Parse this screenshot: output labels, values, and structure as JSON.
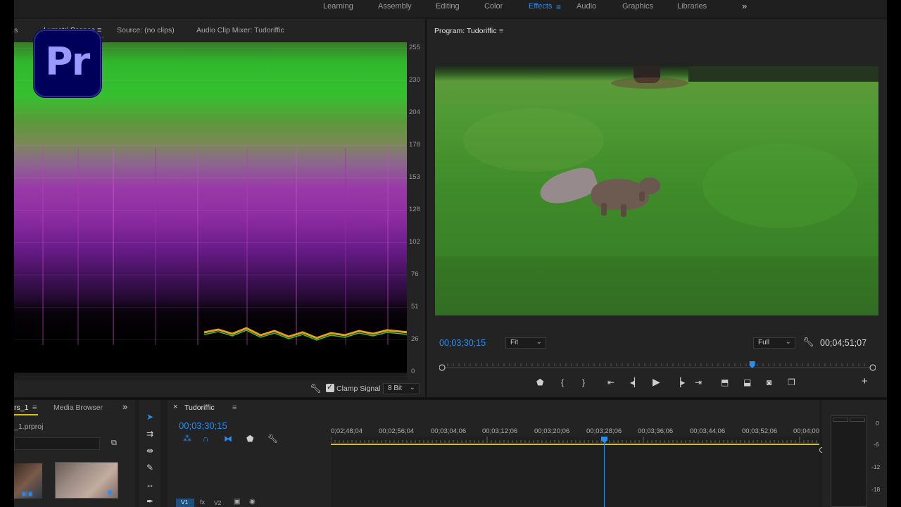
{
  "workspaces": {
    "tabs": [
      "Learning",
      "Assembly",
      "Editing",
      "Color",
      "Effects",
      "Audio",
      "Graphics",
      "Libraries"
    ],
    "active": "Effects",
    "more_icon": "double-chevron-right-icon"
  },
  "logo": {
    "text": "Pr",
    "color": "#9999ff",
    "bg": "#00005b"
  },
  "source_panel": {
    "partial_tab": "s",
    "tabs": [
      "Lumetri Scopes",
      "Source: (no clips)",
      "Audio Clip Mixer: Tudoriffic"
    ],
    "scale": [
      "255",
      "230",
      "204",
      "178",
      "153",
      "128",
      "102",
      "76",
      "51",
      "26",
      "0"
    ],
    "clamp_label": "Clamp Signal",
    "bit_depth": "8 Bit"
  },
  "program": {
    "title": "Program: Tudoriffic",
    "timecode": "00;03;30;15",
    "zoom": "Fit",
    "quality": "Full",
    "duration": "00;04;51;07",
    "playhead_fraction": 0.72
  },
  "project": {
    "tab": "rs_1",
    "media_browser": "Media Browser",
    "file": "_1.prproj"
  },
  "timeline": {
    "sequence": "Tudoriffic",
    "timecode": "00;03;30;15",
    "ruler": [
      "0;02;48;04",
      "00;02;56;04",
      "00;03;04;06",
      "00;03;12;06",
      "00;03;20;06",
      "00;03;28;06",
      "00;03;36;06",
      "00;03;44;06",
      "00;03;52;06",
      "00;04;00"
    ],
    "track_labels": [
      "V1",
      "V2"
    ]
  },
  "meters": {
    "scale": [
      "0",
      "-6",
      "-12",
      "-18"
    ]
  },
  "colors": {
    "accent": "#2d8ceb",
    "panel": "#232323",
    "bg": "#1d1d1d",
    "playhead_bar": "#d6c21e"
  }
}
